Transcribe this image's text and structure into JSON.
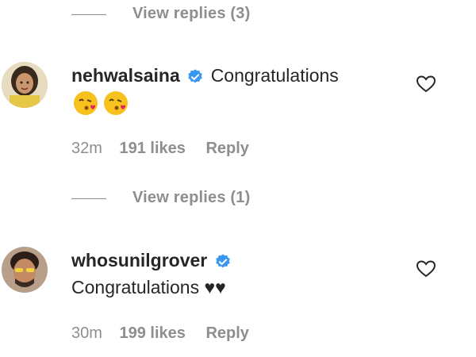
{
  "comments": [
    {
      "username": "nehwalsaina",
      "text": "Congratulations",
      "emojis": [
        "kissing-heart-emoji",
        "kissing-heart-emoji"
      ],
      "time": "32m",
      "likes": "191 likes",
      "reply_label": "Reply",
      "verified": true
    },
    {
      "username": "whosunilgrover",
      "text": "Congratulations ♥♥",
      "time": "30m",
      "likes": "199 likes",
      "reply_label": "Reply",
      "verified": true
    }
  ],
  "view_replies": [
    {
      "label": "View replies (3)"
    },
    {
      "label": "View replies (1)"
    }
  ],
  "colors": {
    "text": "#262626",
    "secondary": "#8e8e8e",
    "verified_blue": "#3897f0"
  }
}
